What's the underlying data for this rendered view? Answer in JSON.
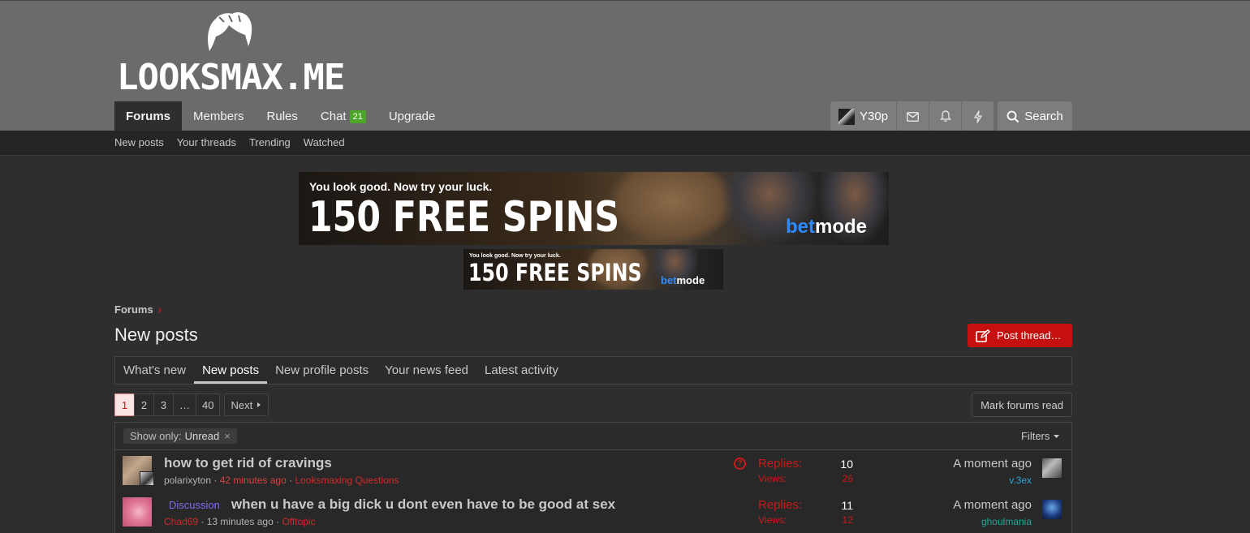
{
  "site": {
    "logo_text": "LOOKSMAX.ME"
  },
  "nav": {
    "tabs": [
      {
        "label": "Forums"
      },
      {
        "label": "Members"
      },
      {
        "label": "Rules"
      },
      {
        "label": "Chat",
        "badge": "21"
      },
      {
        "label": "Upgrade"
      }
    ]
  },
  "account": {
    "username": "Y30p",
    "search_label": "Search"
  },
  "subnav": {
    "items": [
      "New posts",
      "Your threads",
      "Trending",
      "Watched"
    ]
  },
  "ad": {
    "tagline": "You look good. Now try your luck.",
    "headline": "150 FREE SPINS",
    "brand_a": "bet",
    "brand_b": "mode",
    "brand_color": "#2e8bff"
  },
  "breadcrumb": {
    "item": "Forums",
    "separator": "›"
  },
  "page": {
    "title": "New posts",
    "post_thread_label": "Post thread…"
  },
  "tabs": [
    {
      "label": "What's new"
    },
    {
      "label": "New posts"
    },
    {
      "label": "New profile posts"
    },
    {
      "label": "Your news feed"
    },
    {
      "label": "Latest activity"
    }
  ],
  "pagination": {
    "pages": [
      "1",
      "2",
      "3",
      "…",
      "40"
    ],
    "next_label": "Next"
  },
  "actions": {
    "mark_read_label": "Mark forums read"
  },
  "filter": {
    "prefix": "Show only:",
    "value": "Unread",
    "remove": "×",
    "filters_label": "Filters"
  },
  "threads": [
    {
      "prefix": "",
      "title": "how to get rid of cravings",
      "author": "polarixyton",
      "time": "42 minutes ago",
      "forum": "Looksmaxing Questions",
      "question": true,
      "replies_label": "Replies:",
      "replies": "10",
      "views_label": "Views:",
      "views": "26",
      "latest_time": "A moment ago",
      "latest_user": "v.3ex",
      "latest_user_color": "#2aa6d8"
    },
    {
      "prefix": "Discussion",
      "title": "when u have a big dick u dont even have to be good at sex",
      "author": "Chad69",
      "time": "13 minutes ago",
      "forum": "Offtopic",
      "question": false,
      "replies_label": "Replies:",
      "replies": "11",
      "views_label": "Views:",
      "views": "12",
      "latest_time": "A moment ago",
      "latest_user": "ghoulmania",
      "latest_user_color": "#21a89a"
    }
  ],
  "colors": {
    "accent_red": "#c60f0f",
    "header_gray": "#6b6b6b",
    "badge_green": "#4ea629"
  }
}
